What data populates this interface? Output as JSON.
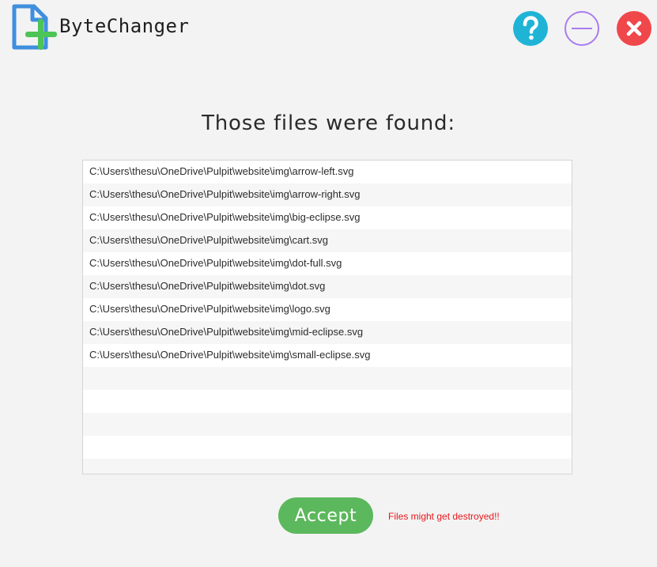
{
  "app": {
    "title": "ByteChanger",
    "logo_icon": "file-add-icon"
  },
  "window_controls": {
    "help_icon": "question-mark-icon",
    "minimize_icon": "minus-icon",
    "close_icon": "x-icon",
    "colors": {
      "help": "#1fb4d6",
      "minimize": "#a97cf0",
      "close": "#f0474b"
    }
  },
  "main": {
    "heading": "Those files were found:",
    "files": [
      "C:\\Users\\thesu\\OneDrive\\Pulpit\\website\\img\\arrow-left.svg",
      "C:\\Users\\thesu\\OneDrive\\Pulpit\\website\\img\\arrow-right.svg",
      "C:\\Users\\thesu\\OneDrive\\Pulpit\\website\\img\\big-eclipse.svg",
      "C:\\Users\\thesu\\OneDrive\\Pulpit\\website\\img\\cart.svg",
      "C:\\Users\\thesu\\OneDrive\\Pulpit\\website\\img\\dot-full.svg",
      "C:\\Users\\thesu\\OneDrive\\Pulpit\\website\\img\\dot.svg",
      "C:\\Users\\thesu\\OneDrive\\Pulpit\\website\\img\\logo.svg",
      "C:\\Users\\thesu\\OneDrive\\Pulpit\\website\\img\\mid-eclipse.svg",
      "C:\\Users\\thesu\\OneDrive\\Pulpit\\website\\img\\small-eclipse.svg"
    ],
    "accept_label": "Accept",
    "warning": "Files might get destroyed!!",
    "colors": {
      "accept": "#5cb85c",
      "warning": "#e8171b"
    }
  }
}
